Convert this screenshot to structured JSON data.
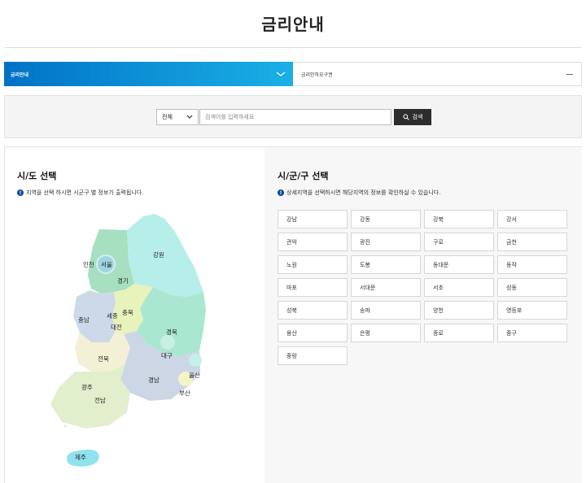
{
  "page": {
    "title": "금리안내"
  },
  "tabs": [
    {
      "label": "금리안내",
      "active": true
    },
    {
      "label": "금리인하요구권",
      "active": false
    }
  ],
  "search": {
    "select_value": "전체",
    "placeholder": "검색어를 입력하세요",
    "button_label": "검색"
  },
  "left": {
    "title": "시/도 선택",
    "description": "지역을 선택 하시면 시군구 별 정보가 출력됩니다."
  },
  "right": {
    "title": "시/군/구 선택",
    "description": "상세지역을 선택하시면 해당지역의 정보를 확인하실 수 있습니다."
  },
  "map_regions": [
    "인천",
    "서울",
    "강원",
    "경기",
    "충남",
    "세종",
    "충북",
    "대전",
    "경북",
    "대구",
    "전북",
    "울산",
    "경남",
    "광주",
    "부산",
    "전남",
    "제주"
  ],
  "districts": [
    "강남",
    "강동",
    "강북",
    "강서",
    "관악",
    "광진",
    "구로",
    "금천",
    "노원",
    "도봉",
    "동대문",
    "동작",
    "마포",
    "서대문",
    "서초",
    "성동",
    "성북",
    "송파",
    "양천",
    "영등포",
    "용산",
    "은평",
    "종로",
    "중구",
    "중랑"
  ],
  "colors": {
    "tab_gradient_start": "#0072c6",
    "tab_gradient_end": "#1ab0e6",
    "search_button": "#2d2d2d",
    "info_icon": "#0a4aa0"
  }
}
